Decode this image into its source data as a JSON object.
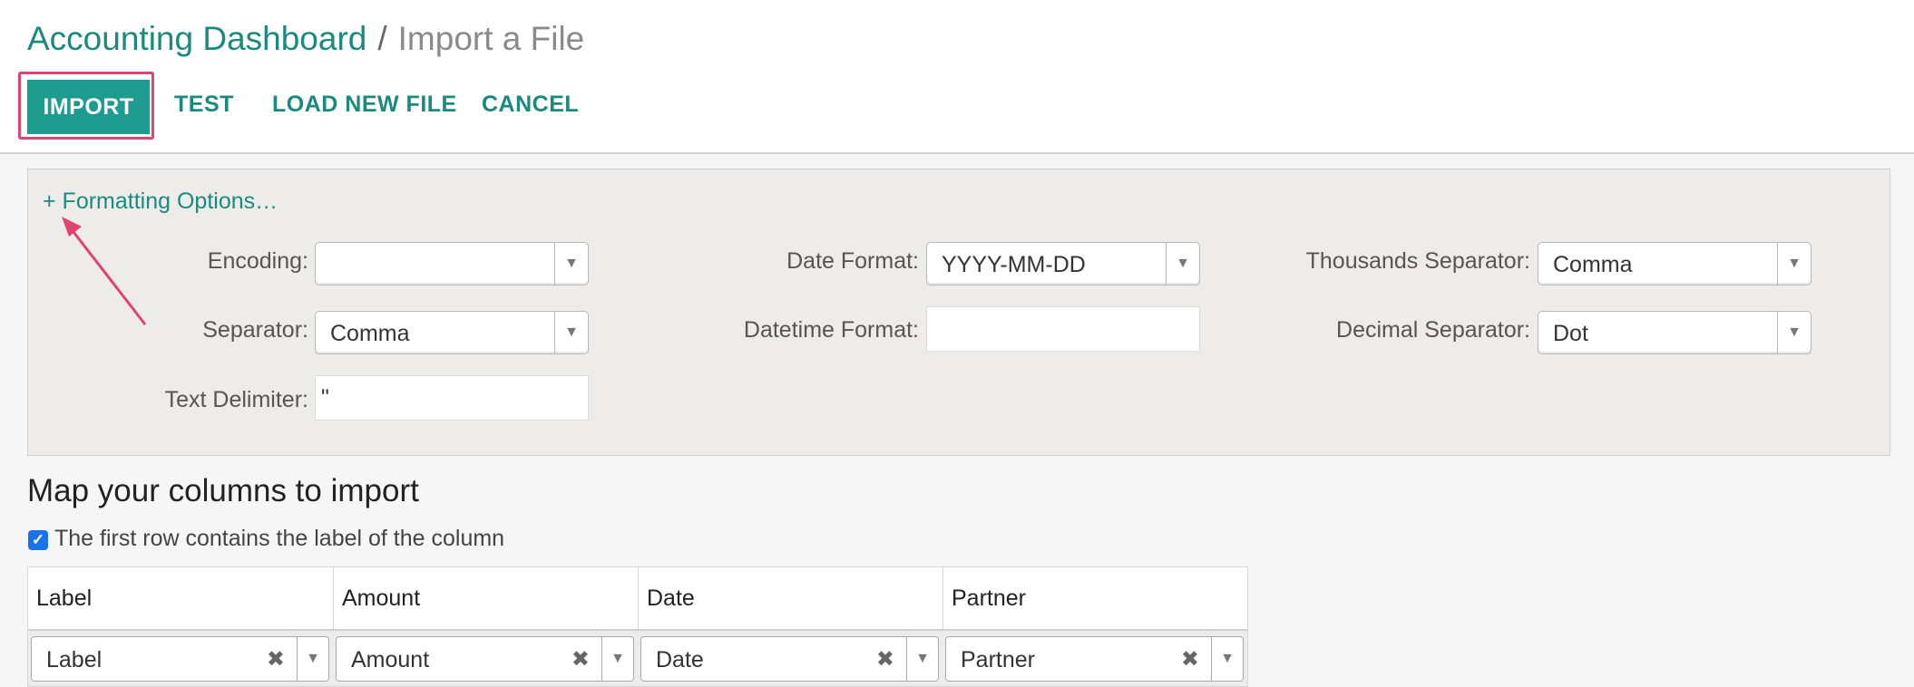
{
  "breadcrumb": {
    "parent": "Accounting Dashboard",
    "separator": "/",
    "current": "Import a File"
  },
  "toolbar": {
    "import_label": "IMPORT",
    "test_label": "TEST",
    "load_new_file_label": "LOAD NEW FILE",
    "cancel_label": "CANCEL"
  },
  "formatting": {
    "toggle_label": "+ Formatting Options…",
    "encoding": {
      "label": "Encoding:",
      "value": ""
    },
    "separator": {
      "label": "Separator:",
      "value": "Comma"
    },
    "text_delimiter": {
      "label": "Text Delimiter:",
      "value": "\""
    },
    "date_format": {
      "label": "Date Format:",
      "value": "YYYY-MM-DD"
    },
    "datetime_format": {
      "label": "Datetime Format:",
      "value": ""
    },
    "thousands_separator": {
      "label": "Thousands Separator:",
      "value": "Comma"
    },
    "decimal_separator": {
      "label": "Decimal Separator:",
      "value": "Dot"
    }
  },
  "mapping": {
    "title": "Map your columns to import",
    "first_row_checkbox": {
      "label": "The first row contains the label of the column",
      "checked": true
    },
    "columns": [
      {
        "header": "Label",
        "field": "Label"
      },
      {
        "header": "Amount",
        "field": "Amount"
      },
      {
        "header": "Date",
        "field": "Date"
      },
      {
        "header": "Partner",
        "field": "Partner"
      }
    ]
  },
  "icons": {
    "dropdown": "caret-down-icon",
    "clear": "clear-x-icon",
    "checkbox": "checkmark-icon"
  },
  "colors": {
    "primary": "#1f9a8f",
    "link": "#1b8a7e",
    "annotation": "#e0436f",
    "checkbox": "#1a73e8"
  }
}
